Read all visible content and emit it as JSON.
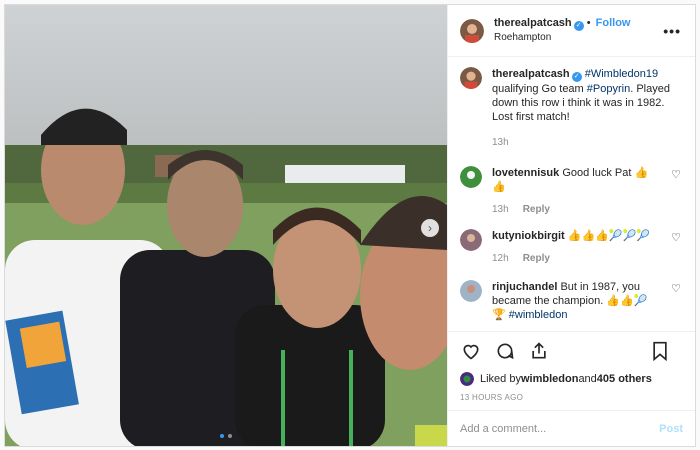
{
  "post": {
    "author": "therealpatcash",
    "follow_label": "Follow",
    "location": "Roehampton",
    "more_label": "•••",
    "accent_color": "#3897f0"
  },
  "caption": {
    "author": "therealpatcash",
    "text_parts": [
      "#Wimbledon19",
      " qualifying Go team ",
      "#Popyrin",
      ". Played down this row i think it was in 1982. Lost first match!"
    ],
    "time": "13h"
  },
  "comments": [
    {
      "author": "lovetennisuk",
      "text": "Good luck Pat 👍👍",
      "time": "13h",
      "reply_label": "Reply"
    },
    {
      "author": "kutyniokbirgit",
      "text": "👍👍👍🎾🎾🎾",
      "time": "12h",
      "reply_label": "Reply"
    },
    {
      "author": "rinjuchandel",
      "text_parts": [
        "But in 1987, you became the champion. 👍👍🎾 🏆 ",
        "#wimbledon"
      ]
    }
  ],
  "likes": {
    "prefix": "Liked by ",
    "user": "wimbledon",
    "middle": " and ",
    "count": "405 others"
  },
  "timestamp": "13 HOURS AGO",
  "comment_box": {
    "placeholder": "Add a comment...",
    "post_label": "Post"
  },
  "photo": {
    "slide_count": 2,
    "active_slide": 1,
    "next_label": "›"
  }
}
